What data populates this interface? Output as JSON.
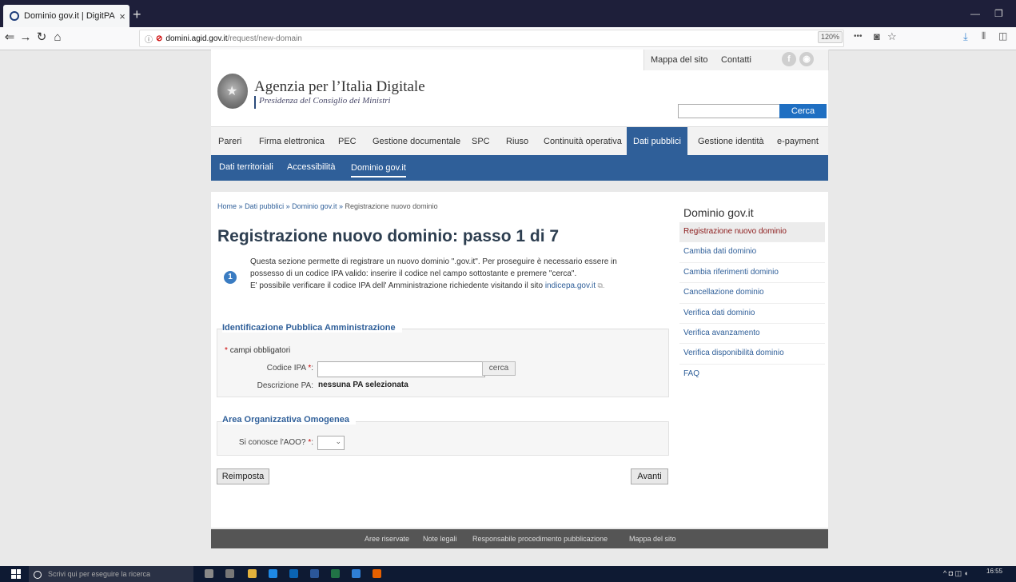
{
  "browser": {
    "tab_title": "Dominio gov.it | DigitPA",
    "tab_close": "×",
    "new_tab": "+",
    "url_domain": "domini.agid.gov.it",
    "url_path": "/request/new-domain",
    "zoom": "120%",
    "more": "•••"
  },
  "header": {
    "top_links": [
      "Mappa del sito",
      "Contatti"
    ],
    "agency_name": "Agenzia per l’Italia Digitale",
    "agency_sub": "Presidenza del Consiglio dei Ministri",
    "search_button": "Cerca"
  },
  "main_nav": [
    "Pareri",
    "Firma elettronica",
    "PEC",
    "Gestione documentale",
    "SPC",
    "Riuso",
    "Continuità operativa",
    "Dati pubblici",
    "Gestione identità",
    "e-payment"
  ],
  "main_nav_active": "Dati pubblici",
  "sub_nav": [
    "Dati territoriali",
    "Accessibilità",
    "Dominio gov.it"
  ],
  "breadcrumb": {
    "home": "Home",
    "sep": "»",
    "l1": "Dati pubblici",
    "l2": "Dominio gov.it",
    "current": "Registrazione nuovo dominio"
  },
  "page_title": "Registrazione nuovo dominio: passo 1 di 7",
  "intro": {
    "badge": "1",
    "line1": "Questa sezione permette di registrare un nuovo dominio \".gov.it\". Per proseguire è necessario essere in",
    "line2": "possesso di un codice IPA valido: inserire il codice nel campo sottostante e premere \"cerca\".",
    "line3_prefix": "E' possibile verificare il codice IPA dell' Amministrazione richiedente visitando il sito ",
    "line3_link": "indicepa.gov.it"
  },
  "form1": {
    "legend": "Identificazione Pubblica Amministrazione",
    "required_note": "campi obbligatori",
    "required_mark": "*",
    "codice_label": "Codice IPA",
    "codice_value": "",
    "cerca_button": "cerca",
    "descrizione_label": "Descrizione PA:",
    "descrizione_value": "nessuna PA selezionata"
  },
  "form2": {
    "legend": "Area Organizzativa Omogenea",
    "aoo_label": "Si conosce l'AOO?",
    "aoo_value": ""
  },
  "buttons": {
    "reset": "Reimposta",
    "next": "Avanti"
  },
  "sidebar": {
    "title": "Dominio gov.it",
    "items": [
      "Registrazione nuovo dominio",
      "Cambia dati dominio",
      "Cambia riferimenti dominio",
      "Cancellazione dominio",
      "Verifica dati dominio",
      "Verifica avanzamento",
      "Verifica disponibilità dominio",
      "FAQ"
    ],
    "active": "Registrazione nuovo dominio"
  },
  "footer": [
    "Aree riservate",
    "Note legali",
    "Responsabile procedimento pubblicazione",
    "Mappa del sito"
  ],
  "taskbar": {
    "search_placeholder": "Scrivi qui per eseguire la ricerca",
    "time": "16:55"
  },
  "colors": {
    "nav_blue": "#2f5f99",
    "search_btn": "#1f6fc2",
    "active_sidebar_text": "#8b1a1a"
  }
}
